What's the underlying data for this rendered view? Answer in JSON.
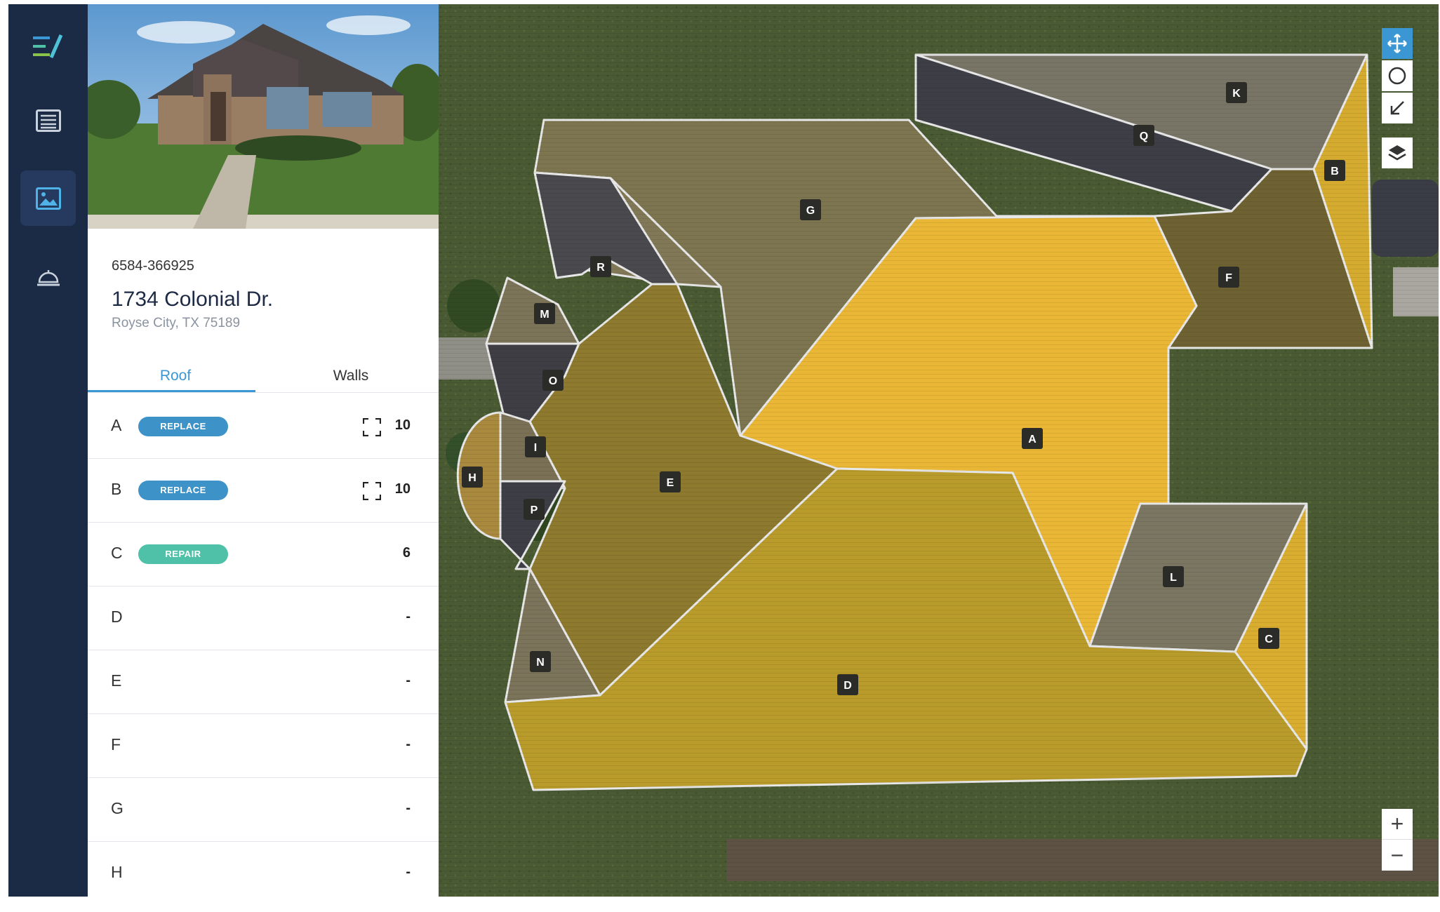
{
  "app": {
    "logo_icon": "app-logo-icon"
  },
  "nav": {
    "items": [
      {
        "icon": "document-list-icon",
        "active": false
      },
      {
        "icon": "image-icon",
        "active": true
      },
      {
        "icon": "service-bell-icon",
        "active": false
      }
    ]
  },
  "claim": {
    "number": "6584-366925",
    "address": "1734 Colonial Dr.",
    "city": "Royse City, TX 75189"
  },
  "tabs": {
    "roof": "Roof",
    "walls": "Walls"
  },
  "rows": [
    {
      "letter": "A",
      "badge": "REPLACE",
      "badge_type": "replace",
      "value": "10",
      "expand": true
    },
    {
      "letter": "B",
      "badge": "REPLACE",
      "badge_type": "replace",
      "value": "10",
      "expand": true
    },
    {
      "letter": "C",
      "badge": "REPAIR",
      "badge_type": "repair",
      "value": "6",
      "expand": false
    },
    {
      "letter": "D",
      "value": "-"
    },
    {
      "letter": "E",
      "value": "-"
    },
    {
      "letter": "F",
      "value": "-"
    },
    {
      "letter": "G",
      "value": "-"
    },
    {
      "letter": "H",
      "value": "-"
    }
  ],
  "map": {
    "facet_labels": [
      "A",
      "B",
      "C",
      "D",
      "E",
      "F",
      "G",
      "H",
      "I",
      "K",
      "L",
      "M",
      "N",
      "O",
      "P",
      "Q",
      "R"
    ],
    "colors": {
      "replace": "#f2c02b",
      "repair": "#e6c03a",
      "dark_facet": "#3d3d46",
      "outline": "#e7e7e7",
      "label_bg": "#2b2b28",
      "accent": "#3b97d3"
    },
    "tools": [
      "move-icon",
      "circle-draw-icon",
      "arrow-down-left-icon",
      "layers-icon"
    ],
    "zoom_in": "+",
    "zoom_out": "−"
  }
}
